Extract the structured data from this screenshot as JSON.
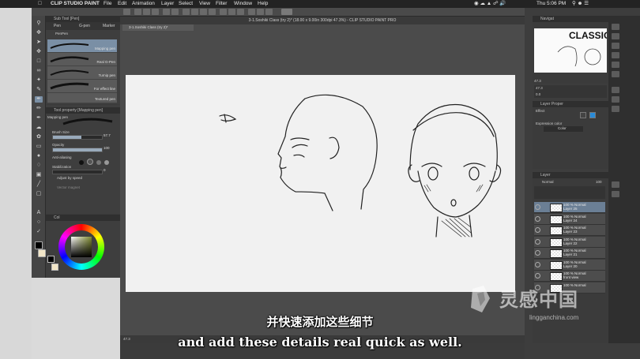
{
  "menubar": {
    "app_name": "CLIP STUDIO PAINT",
    "items": [
      "File",
      "Edit",
      "Animation",
      "Layer",
      "Select",
      "View",
      "Filter",
      "Window",
      "Help"
    ],
    "clock": "Thu 5:06 PM"
  },
  "document": {
    "title": "3-1.Soshiki Class (try 2)* (18.00 x 9.00in 300dpi 47.3%) - CLIP STUDIO PAINT PRO",
    "tab": "3-1.Soshiki Class (try 2)*",
    "zoom": "47.3"
  },
  "subtool": {
    "header": "Sub Tool [Pen]",
    "tabs": [
      "Pen",
      "G-pen",
      "Marker"
    ],
    "group": "PenPen",
    "brushes": [
      "Mapping pen",
      "Real G-Pen",
      "Turnip pen",
      "For effect line",
      "Textured pen"
    ]
  },
  "toolprop": {
    "header": "Tool property [Mapping pen]",
    "name": "Mapping pen",
    "brush_size_label": "Brush Size",
    "brush_size": "57.7",
    "brush_size_level": 0.58,
    "opacity_label": "Opacity",
    "opacity": "100",
    "opacity_level": 1.0,
    "anti_label": "Anti-aliasing",
    "stab_label": "Stabilization",
    "stab_value": "0",
    "adjust_label": "Adjust by speed",
    "vector_label": "Vector magnet"
  },
  "color": {
    "header": "Col",
    "main": "#000000",
    "sub": "#f2e6c8"
  },
  "navigator": {
    "header": "Navigat",
    "preview_text": "CLASSIO",
    "zoom": "47.3",
    "angle": "0.0"
  },
  "layerprop": {
    "header": "Layer Proper",
    "effect": "Effect",
    "expression_label": "Expression color",
    "expression_value": "Color"
  },
  "layers": {
    "header": "Layer",
    "blend": "Normal",
    "opacity": "100",
    "items": [
      {
        "l1": "100 % Normal",
        "l2": "Layer 25",
        "selected": true
      },
      {
        "l1": "100 % Normal",
        "l2": "Layer 24",
        "selected": false
      },
      {
        "l1": "100 % Normal",
        "l2": "Layer 23",
        "selected": false
      },
      {
        "l1": "100 % Normal",
        "l2": "Layer 22",
        "selected": false
      },
      {
        "l1": "100 % Normal",
        "l2": "Layer 21",
        "selected": false
      },
      {
        "l1": "100 % Normal",
        "l2": "Layer 20",
        "selected": false
      },
      {
        "l1": "100 % Normal",
        "l2": "front view",
        "selected": false
      },
      {
        "l1": "100 % Normal",
        "l2": "",
        "selected": false
      }
    ]
  },
  "subtitles": {
    "zh": "并快速添加这些细节",
    "en": "and add these details real quick as well."
  },
  "watermark": {
    "zh": "灵感中国",
    "url": "lingganchina.com"
  },
  "colors": {
    "selection": "#7a8fa5",
    "canvas": "#f1f1f1"
  }
}
